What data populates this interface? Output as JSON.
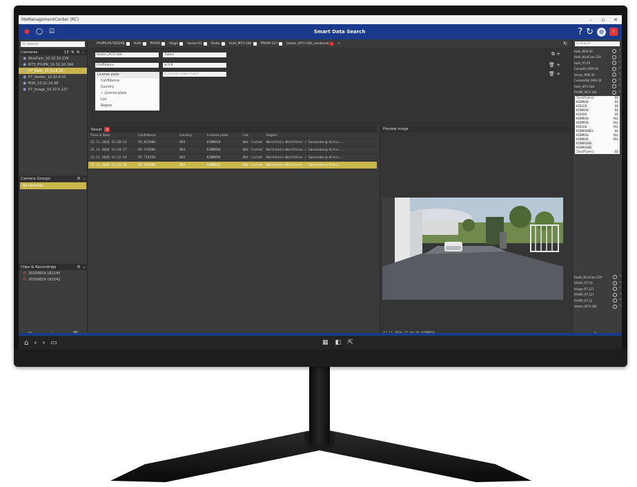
{
  "window": {
    "title": "MxManagementCenter (RC)",
    "controls": [
      "–",
      "▫",
      "✕"
    ]
  },
  "app": {
    "title": "Smart Data Search"
  },
  "left": {
    "search_placeholder": "Q Search",
    "cameras_label": "Cameras",
    "cameras_count": "15",
    "cameras": [
      {
        "name": "NicoCam_10.32.10.229",
        "selected": false
      },
      {
        "name": "M73_PYUPR_10.32.10.184",
        "selected": false
      },
      {
        "name": "P7_Halls_10.32.8.29",
        "selected": true
      },
      {
        "name": "P7_Verifer_10.32.8.53",
        "selected": false
      },
      {
        "name": "M26_10.22.10.38",
        "selected": false
      },
      {
        "name": "P7_Image_10.32.5.127",
        "selected": false
      }
    ],
    "groups_label": "Camera Groups",
    "groups": [
      {
        "name": "All cameras"
      }
    ],
    "clips_label": "Clips & Recordings",
    "clips": [
      {
        "name": "20200819-181140"
      },
      {
        "name": "20200819-181542"
      }
    ]
  },
  "filters": {
    "tabs": [
      {
        "label": "PYUPR-PS-TERZAB",
        "red": false
      },
      {
        "label": "Huth",
        "red": false
      },
      {
        "label": "PPUPR",
        "red": false
      },
      {
        "label": "Stage",
        "red": false
      },
      {
        "label": "Vanter-S1",
        "red": false
      },
      {
        "label": "Radio",
        "red": false
      },
      {
        "label": "Huth_M73-184",
        "red": false
      },
      {
        "label": "PPUPR-127",
        "red": false
      },
      {
        "label": "Vanter_M73-184_combined",
        "red": true
      }
    ],
    "field1": "Vanter_M73-184",
    "field2": "Tables",
    "field3": "Confidence",
    "field4": "≥ 0.8",
    "field5": "License plate",
    "field6_placeholder": "Q  License plate match",
    "dropdown_options": [
      "License plate",
      "Confidence",
      "Country",
      "✓ License plate",
      "List",
      "Region"
    ]
  },
  "results": {
    "label": "Result",
    "count": "4",
    "columns": [
      "Time & Date",
      "Confidence",
      "Country",
      "License plate",
      "List",
      "Region"
    ],
    "rows": [
      {
        "time": "22.11.2020 15:20:23",
        "conf": "95.823500",
        "country": "DEU",
        "plate": "KIBM850",
        "list": "Not listed",
        "region": "Nordrhein-Westfalen / Sonnenberg-Kreis...",
        "selected": false
      },
      {
        "time": "22.11.2020 15:20:27",
        "conf": "95.373500",
        "country": "DEU",
        "plate": "KIBM850",
        "list": "Not listed",
        "region": "Nordrhein-Westfalen / Sonnenberg-Kreis...",
        "selected": false
      },
      {
        "time": "22.11.2020 15:22:54",
        "conf": "95.714250",
        "country": "DEU",
        "plate": "KIBM850",
        "list": "Not listed",
        "region": "Nordrhein-Westfalen / Sonnenberg-Kreis...",
        "selected": false
      },
      {
        "time": "22.11.2020 15:22:56",
        "conf": "95.503500",
        "country": "DEU",
        "plate": "KIBM850",
        "list": "Not listed",
        "region": "Nordrhein-Westfalen / Sonnenberg-Kreis...",
        "selected": true
      }
    ]
  },
  "preview": {
    "label": "Preview Image",
    "footer": "22.11.2020  15:20:56  KIBM850"
  },
  "right": {
    "search_placeholder": "Q Search",
    "cams_top": [
      "Huth_M26-30",
      "Huth_NicoCam-229",
      "Huth_P7-29",
      "Carsader_M26-30",
      "Vector_M26-30",
      "CustomPoll_M26-30",
      "Huth_M73-184",
      "PYUPR_M73-184"
    ],
    "plates": [
      {
        "plate": "TestPlate1",
        "c": "DE"
      },
      {
        "plate": "KIBM850",
        "c": "DE"
      },
      {
        "plate": "KIBCE8",
        "c": "DE"
      },
      {
        "plate": "KIBM850",
        "c": "DE"
      },
      {
        "plate": "KIBCE8",
        "c": "DE"
      },
      {
        "plate": "KIBM850",
        "c": "POL"
      },
      {
        "plate": "KIBM850",
        "c": "POL"
      },
      {
        "plate": "KIBCE8",
        "c": "POL"
      },
      {
        "plate": "KIBM850DEL",
        "c": "DE"
      },
      {
        "plate": "KIBM850",
        "c": "POL"
      },
      {
        "plate": "KIBM850",
        "c": "POL"
      },
      {
        "plate": "KIBM850DE",
        "c": ""
      },
      {
        "plate": "KIBM850DE",
        "c": ""
      },
      {
        "plate": "TestPlate1",
        "c": "DE"
      }
    ],
    "cams_bottom": [
      "Radio_NicoCam-229",
      "Vanter_P7-53",
      "Image_P7-127",
      "PPUPR_P7-127",
      "PYUPR_P7-12",
      "Vanter_M73-184"
    ]
  },
  "colors": {
    "brand": "#1a3a8c",
    "selection": "#c8b64a",
    "alert": "#e0353b"
  }
}
